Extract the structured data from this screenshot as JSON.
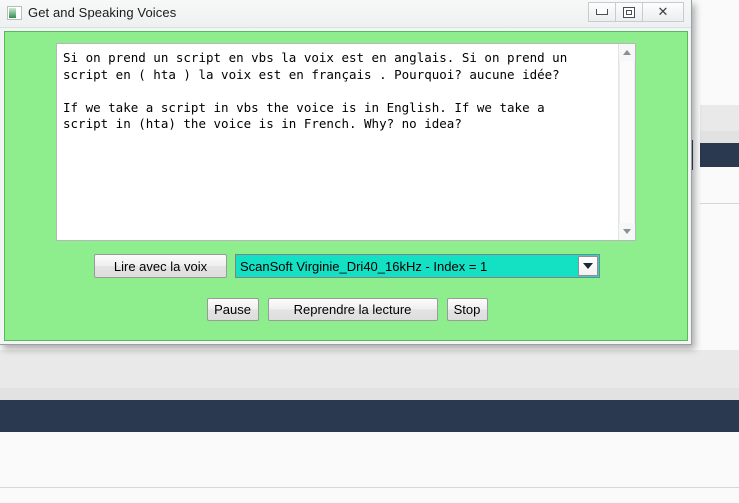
{
  "window": {
    "title": "Get and Speaking Voices",
    "icon": "hta-app-icon",
    "controls": {
      "minimize_label": "Minimize",
      "maximize_label": "Maximize",
      "close_label": "✕"
    },
    "body_color": "#8eee8e"
  },
  "editor": {
    "text": "Si on prend un script en vbs la voix est en anglais. Si on prend un\nscript en ( hta ) la voix est en français . Pourquoi? aucune idée?\n\nIf we take a script in vbs the voice is in English. If we take a\nscript in (hta) the voice is in French. Why? no idea?",
    "scrollbar": {
      "up_icon": "triangle-up-icon",
      "down_icon": "triangle-down-icon"
    }
  },
  "controls": {
    "read_button_label": "Lire avec la voix",
    "voice_select": {
      "selected": "ScanSoft Virginie_Dri40_16kHz - Index = 1",
      "arrow_icon": "chevron-down-icon",
      "background_color": "#14e0c4"
    },
    "pause_button_label": "Pause",
    "resume_button_label": "Reprendre la lecture",
    "stop_button_label": "Stop"
  },
  "backdrop": {
    "navy_color": "#2a3850",
    "gray_color": "#e9e9e9"
  }
}
